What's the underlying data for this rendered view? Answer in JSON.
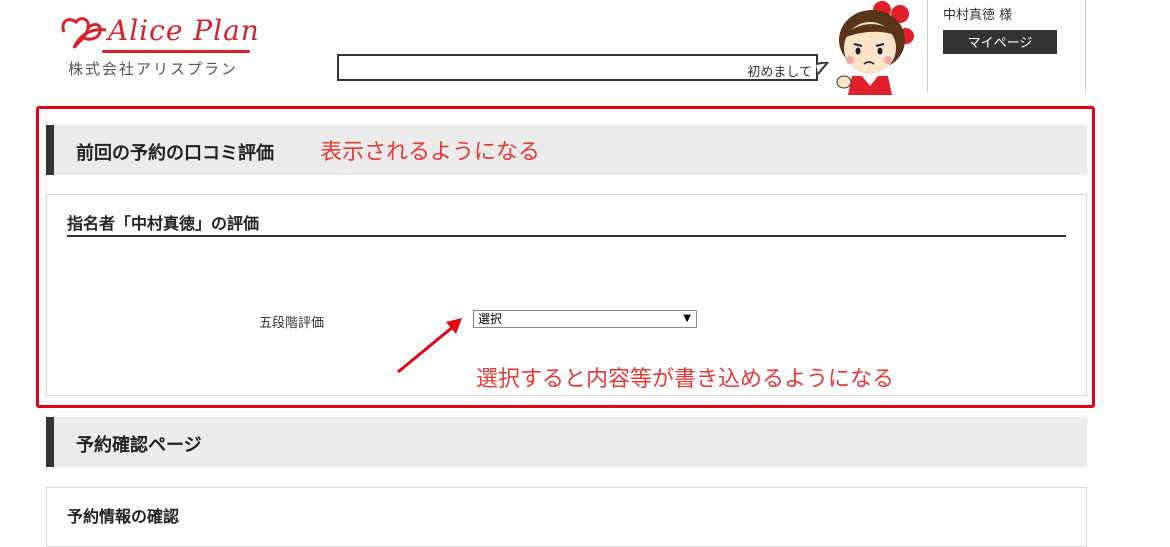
{
  "header": {
    "logo_text": "Alice Plan",
    "logo_subtitle": "株式会社アリスプラン",
    "greeting": "初めまして",
    "user_name": "中村真徳 様",
    "mypage_label": "マイページ"
  },
  "sections": {
    "review": {
      "title": "前回の予約の口コミ評価",
      "panel_title": "指名者「中村真徳」の評価",
      "rating_label": "五段階評価",
      "select_value": "選択"
    },
    "confirm": {
      "title": "予約確認ページ",
      "panel_title": "予約情報の確認"
    }
  },
  "annotations": {
    "note1": "表示されるようになる",
    "note2": "選択すると内容等が書き込めるようになる"
  },
  "colors": {
    "brand": "#d6232a",
    "annotation": "#e60012",
    "section_bar": "#333333",
    "section_bg": "#ebebeb"
  },
  "icons": {
    "logo": "heart-leaf-logo-icon",
    "character": "mascot-character-icon",
    "arrow": "red-arrow-icon",
    "dropdown": "triangle-down-icon"
  }
}
